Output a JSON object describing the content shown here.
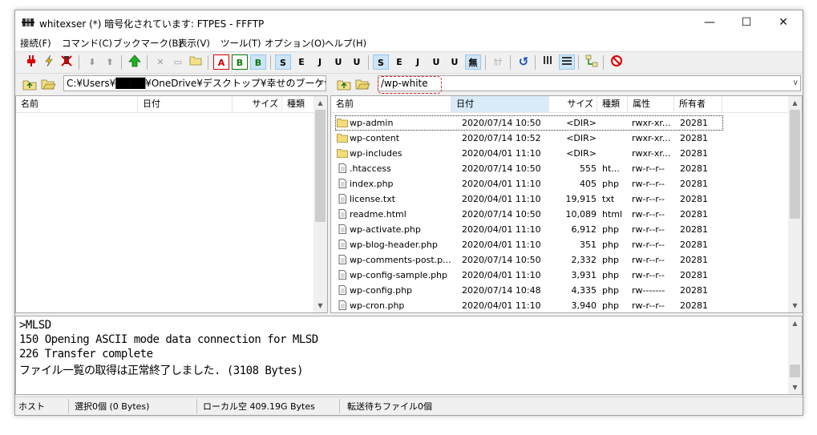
{
  "window": {
    "title": "whitexser (*) 暗号化されています: FTPES - FFFTP",
    "minimize": "—",
    "maximize": "☐",
    "close": "✕"
  },
  "menu": [
    "接続(F)",
    "コマンド(C)",
    "ブックマーク(B)",
    "表示(V)",
    "ツール(T)",
    "オプション(O)",
    "ヘルプ(H)"
  ],
  "toolbar": {
    "ascii_label": "A",
    "binary_label": "B",
    "auto_label": "B",
    "sjis_label": "S",
    "euc_label": "E",
    "jis_label": "J",
    "utf8n_label": "U",
    "utf8bom_label": "U",
    "no_conv_label": "無",
    "kana_label": "ｶﾅ"
  },
  "local": {
    "path": "C:¥Users¥████¥OneDrive¥デスクトップ¥幸せのブーケwl",
    "columns": [
      "名前",
      "日付",
      "サイズ",
      "種類"
    ]
  },
  "remote": {
    "path": "/wp-white",
    "columns": [
      "名前",
      "日付",
      "サイズ",
      "種類",
      "属性",
      "所有者"
    ],
    "files": [
      {
        "name": "wp-admin",
        "date": "2020/07/14 10:50",
        "size": "<DIR>",
        "type": "",
        "attr": "rwxr-xr...",
        "owner": "20281",
        "kind": "folder"
      },
      {
        "name": "wp-content",
        "date": "2020/07/14 10:52",
        "size": "<DIR>",
        "type": "",
        "attr": "rwxr-xr...",
        "owner": "20281",
        "kind": "folder"
      },
      {
        "name": "wp-includes",
        "date": "2020/04/01 11:10",
        "size": "<DIR>",
        "type": "",
        "attr": "rwxr-xr...",
        "owner": "20281",
        "kind": "folder"
      },
      {
        "name": ".htaccess",
        "date": "2020/07/14 10:50",
        "size": "555",
        "type": "ht...",
        "attr": "rw-r--r--",
        "owner": "20281",
        "kind": "file"
      },
      {
        "name": "index.php",
        "date": "2020/04/01 11:10",
        "size": "405",
        "type": "php",
        "attr": "rw-r--r--",
        "owner": "20281",
        "kind": "file"
      },
      {
        "name": "license.txt",
        "date": "2020/04/01 11:10",
        "size": "19,915",
        "type": "txt",
        "attr": "rw-r--r--",
        "owner": "20281",
        "kind": "file"
      },
      {
        "name": "readme.html",
        "date": "2020/07/14 10:50",
        "size": "10,089",
        "type": "html",
        "attr": "rw-r--r--",
        "owner": "20281",
        "kind": "file"
      },
      {
        "name": "wp-activate.php",
        "date": "2020/04/01 11:10",
        "size": "6,912",
        "type": "php",
        "attr": "rw-r--r--",
        "owner": "20281",
        "kind": "file"
      },
      {
        "name": "wp-blog-header.php",
        "date": "2020/04/01 11:10",
        "size": "351",
        "type": "php",
        "attr": "rw-r--r--",
        "owner": "20281",
        "kind": "file"
      },
      {
        "name": "wp-comments-post.p...",
        "date": "2020/07/14 10:50",
        "size": "2,332",
        "type": "php",
        "attr": "rw-r--r--",
        "owner": "20281",
        "kind": "file"
      },
      {
        "name": "wp-config-sample.php",
        "date": "2020/04/01 11:10",
        "size": "3,931",
        "type": "php",
        "attr": "rw-r--r--",
        "owner": "20281",
        "kind": "file"
      },
      {
        "name": "wp-config.php",
        "date": "2020/07/14 10:48",
        "size": "4,335",
        "type": "php",
        "attr": "rw-------",
        "owner": "20281",
        "kind": "file"
      },
      {
        "name": "wp-cron.php",
        "date": "2020/04/01 11:10",
        "size": "3,940",
        "type": "php",
        "attr": "rw-r--r--",
        "owner": "20281",
        "kind": "file"
      }
    ]
  },
  "log": [
    ">MLSD",
    "150 Opening ASCII mode data connection for MLSD",
    "226 Transfer complete",
    "ファイル一覧の取得は正常終了しました. (3108 Bytes)"
  ],
  "status": {
    "host": "ホスト",
    "selection": "選択0個 (0 Bytes)",
    "local_free": "ローカル空 409.19G Bytes",
    "queue": "転送待ちファイル0個"
  },
  "colors": {
    "accent_highlight": "#e02020",
    "selected_header": "#d9ebf9",
    "toolbar_active": "#cce4f7"
  }
}
